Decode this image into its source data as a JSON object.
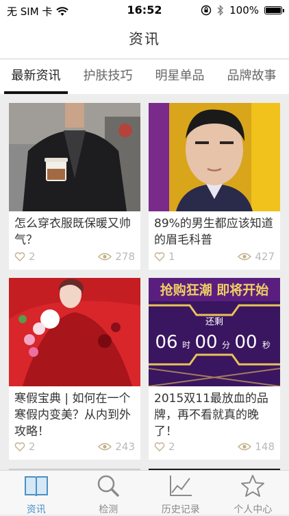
{
  "status": {
    "carrier": "无 SIM 卡",
    "time": "16:52",
    "battery": "100%",
    "battery_level": 1.0
  },
  "header": {
    "title": "资讯"
  },
  "tabs": [
    {
      "label": "最新资讯",
      "active": true
    },
    {
      "label": "护肤技巧",
      "active": false
    },
    {
      "label": "明星单品",
      "active": false
    },
    {
      "label": "品牌故事",
      "active": false
    }
  ],
  "articles": [
    {
      "title": "怎么穿衣服既保暖又帅气？",
      "likes": "2",
      "views": "278"
    },
    {
      "title": "89%的男生都应该知道的眉毛科普",
      "likes": "1",
      "views": "427"
    },
    {
      "title": "寒假宝典 | 如何在一个寒假内变美？从内到外攻略！",
      "likes": "2",
      "views": "243"
    },
    {
      "title": "2015双11最放血的品牌，再不看就真的晚了！",
      "likes": "2",
      "views": "148",
      "banner": {
        "headline": "抢购狂潮 即将开始",
        "remaining": "还剩",
        "hours": "06",
        "h_unit": "时",
        "minutes": "00",
        "m_unit": "分",
        "seconds": "00",
        "s_unit": "秒"
      }
    }
  ],
  "bottom_tabs": [
    {
      "label": "资讯",
      "icon": "book-icon",
      "active": true
    },
    {
      "label": "检测",
      "icon": "magnifier-icon",
      "active": false
    },
    {
      "label": "历史记录",
      "icon": "chart-icon",
      "active": false
    },
    {
      "label": "个人中心",
      "icon": "star-icon",
      "active": false
    }
  ],
  "colors": {
    "accent": "#4a90c8",
    "banner_purple": "#3a1560",
    "banner_gold": "#e9c25a"
  }
}
